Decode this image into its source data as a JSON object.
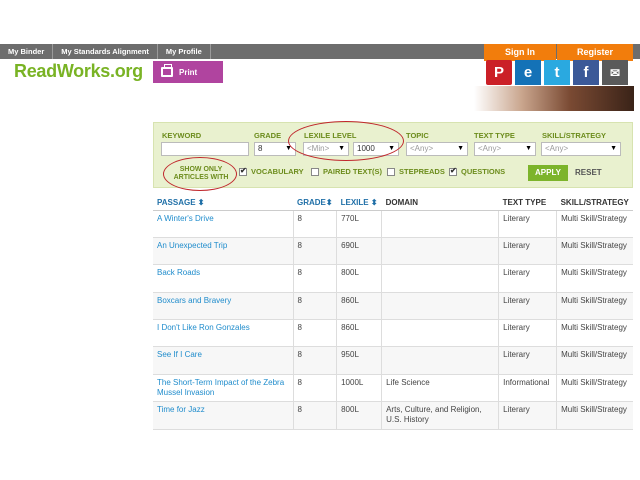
{
  "topnav": {
    "items": [
      "My Binder",
      "My Standards Alignment",
      "My Profile"
    ]
  },
  "auth": {
    "signin": "Sign In",
    "register": "Register"
  },
  "logo": "ReadWorks.org",
  "print_label": "Print",
  "social": {
    "pinterest": "P",
    "edmodo": "e",
    "twitter": "t",
    "facebook": "f",
    "mail": "✉"
  },
  "filters": {
    "keyword_label": "KEYWORD",
    "grade_label": "GRADE",
    "grade_value": "8",
    "lexile_label": "LEXILE LEVEL",
    "lexile_min": "<Min>",
    "lexile_max": "1000",
    "topic_label": "TOPIC",
    "topic_value": "<Any>",
    "texttype_label": "TEXT TYPE",
    "texttype_value": "<Any>",
    "strategy_label": "SKILL/STRATEGY",
    "strategy_value": "<Any>",
    "show_only_line1": "SHOW ONLY",
    "show_only_line2": "ARTICLES WITH",
    "vocabulary": "VOCABULARY",
    "paired": "PAIRED TEXT(S)",
    "stepreads": "STEPREADS",
    "questions": "QUESTIONS",
    "apply": "APPLY",
    "reset": "RESET"
  },
  "table": {
    "headers": [
      "PASSAGE",
      "GRADE",
      "LEXILE",
      "DOMAIN",
      "TEXT TYPE",
      "SKILL/STRATEGY"
    ],
    "rows": [
      [
        "A Winter's Drive",
        "8",
        "770L",
        "",
        "Literary",
        "Multi Skill/Strategy"
      ],
      [
        "An Unexpected Trip",
        "8",
        "690L",
        "",
        "Literary",
        "Multi Skill/Strategy"
      ],
      [
        "Back Roads",
        "8",
        "800L",
        "",
        "Literary",
        "Multi Skill/Strategy"
      ],
      [
        "Boxcars and Bravery",
        "8",
        "860L",
        "",
        "Literary",
        "Multi Skill/Strategy"
      ],
      [
        "I Don't Like Ron Gonzales",
        "8",
        "860L",
        "",
        "Literary",
        "Multi Skill/Strategy"
      ],
      [
        "See If I Care",
        "8",
        "950L",
        "",
        "Literary",
        "Multi Skill/Strategy"
      ],
      [
        "The Short-Term Impact of the Zebra Mussel Invasion",
        "8",
        "1000L",
        "Life Science",
        "Informational",
        "Multi Skill/Strategy"
      ],
      [
        "Time for Jazz",
        "8",
        "800L",
        "Arts, Culture, and Religion, U.S. History",
        "Literary",
        "Multi Skill/Strategy"
      ]
    ]
  }
}
